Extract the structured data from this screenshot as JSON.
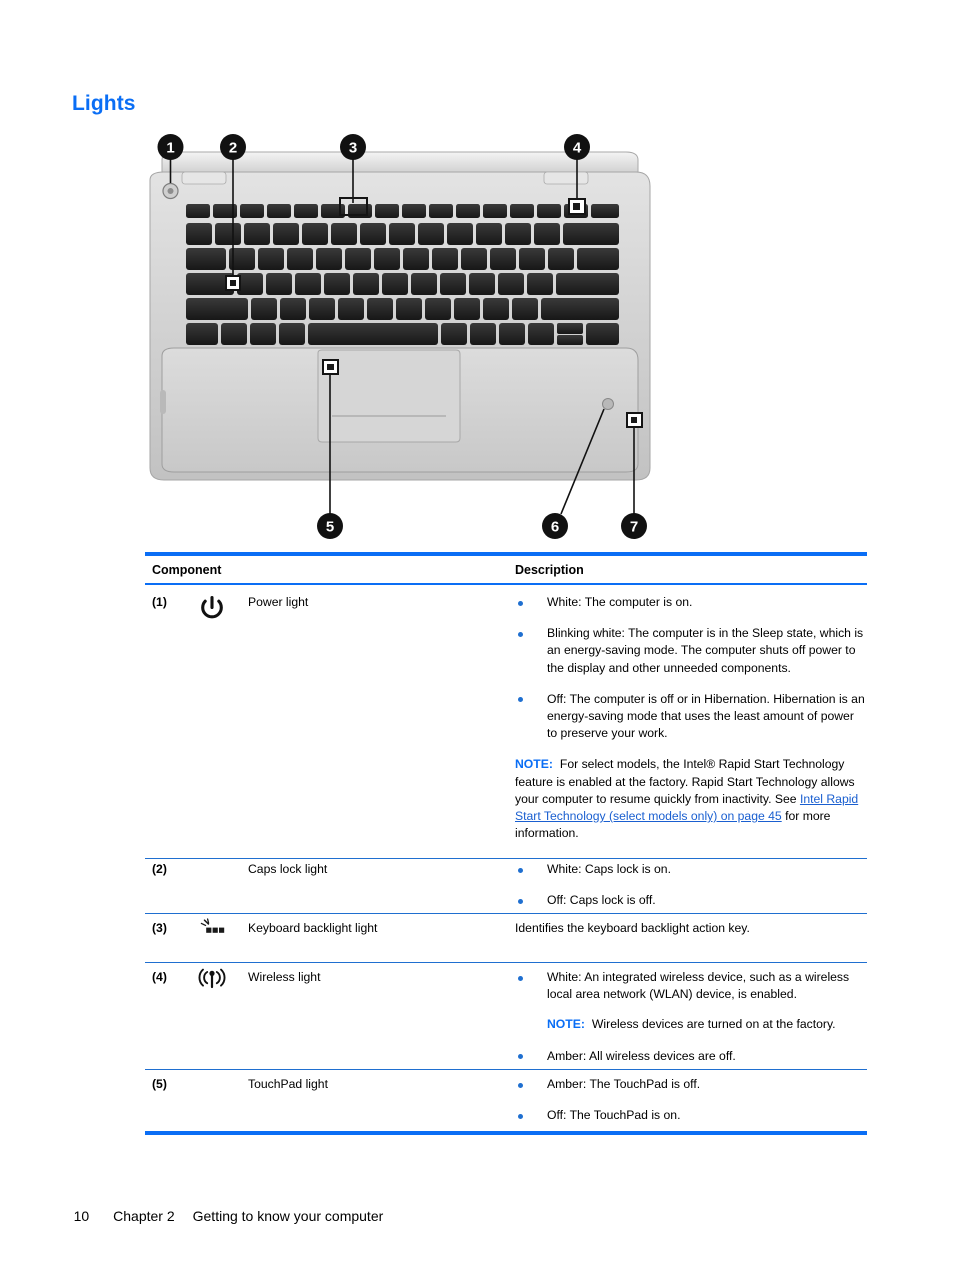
{
  "document": {
    "section_title": "Lights",
    "accent_color": "#0a6ef5",
    "link_color": "#1a5fd0",
    "bullet_color": "#1f6fd0"
  },
  "illustration": {
    "alt": "Top view of notebook computer keyboard and TouchPad with numbered callouts",
    "callouts": [
      "1",
      "2",
      "3",
      "4",
      "5",
      "6",
      "7"
    ]
  },
  "table": {
    "headers": {
      "component": "Component",
      "description": "Description"
    },
    "rows": [
      {
        "num": "(1)",
        "icon": "power-icon",
        "name": "Power light",
        "bullets": [
          "White: The computer is on.",
          "Blinking white: The computer is in the Sleep state, which is an energy-saving mode. The computer shuts off power to the display and other unneeded components.",
          "Off: The computer is off or in Hibernation. Hibernation is an energy-saving mode that uses the least amount of power to preserve your work."
        ],
        "note": {
          "label": "NOTE:",
          "text_before": "For select models, the Intel® Rapid Start Technology feature is enabled at the factory. Rapid Start Technology allows your computer to resume quickly from inactivity. See ",
          "link": "Intel Rapid Start Technology (select models only) on page 45",
          "text_after": " for more information."
        }
      },
      {
        "num": "(2)",
        "icon": "",
        "name": "Caps lock light",
        "bullets": [
          "White: Caps lock is on.",
          "Off: Caps lock is off."
        ]
      },
      {
        "num": "(3)",
        "icon": "keyboard-backlight-icon",
        "name": "Keyboard backlight light",
        "plain": "Identifies the keyboard backlight action key."
      },
      {
        "num": "(4)",
        "icon": "wireless-icon",
        "name": "Wireless light",
        "bullets": [
          "White: An integrated wireless device, such as a wireless local area network (WLAN) device, is enabled.",
          "Amber: All wireless devices are off."
        ],
        "note": {
          "label": "NOTE:",
          "text_before": "Wireless devices are turned on at the factory.",
          "link": "",
          "text_after": ""
        }
      },
      {
        "num": "(5)",
        "icon": "",
        "name": "TouchPad light",
        "bullets": [
          "Amber: The TouchPad is off.",
          "Off: The TouchPad is on."
        ]
      }
    ]
  },
  "footer": {
    "page_number": "10",
    "chapter": "Chapter 2",
    "chapter_title": "Getting to know your computer"
  }
}
